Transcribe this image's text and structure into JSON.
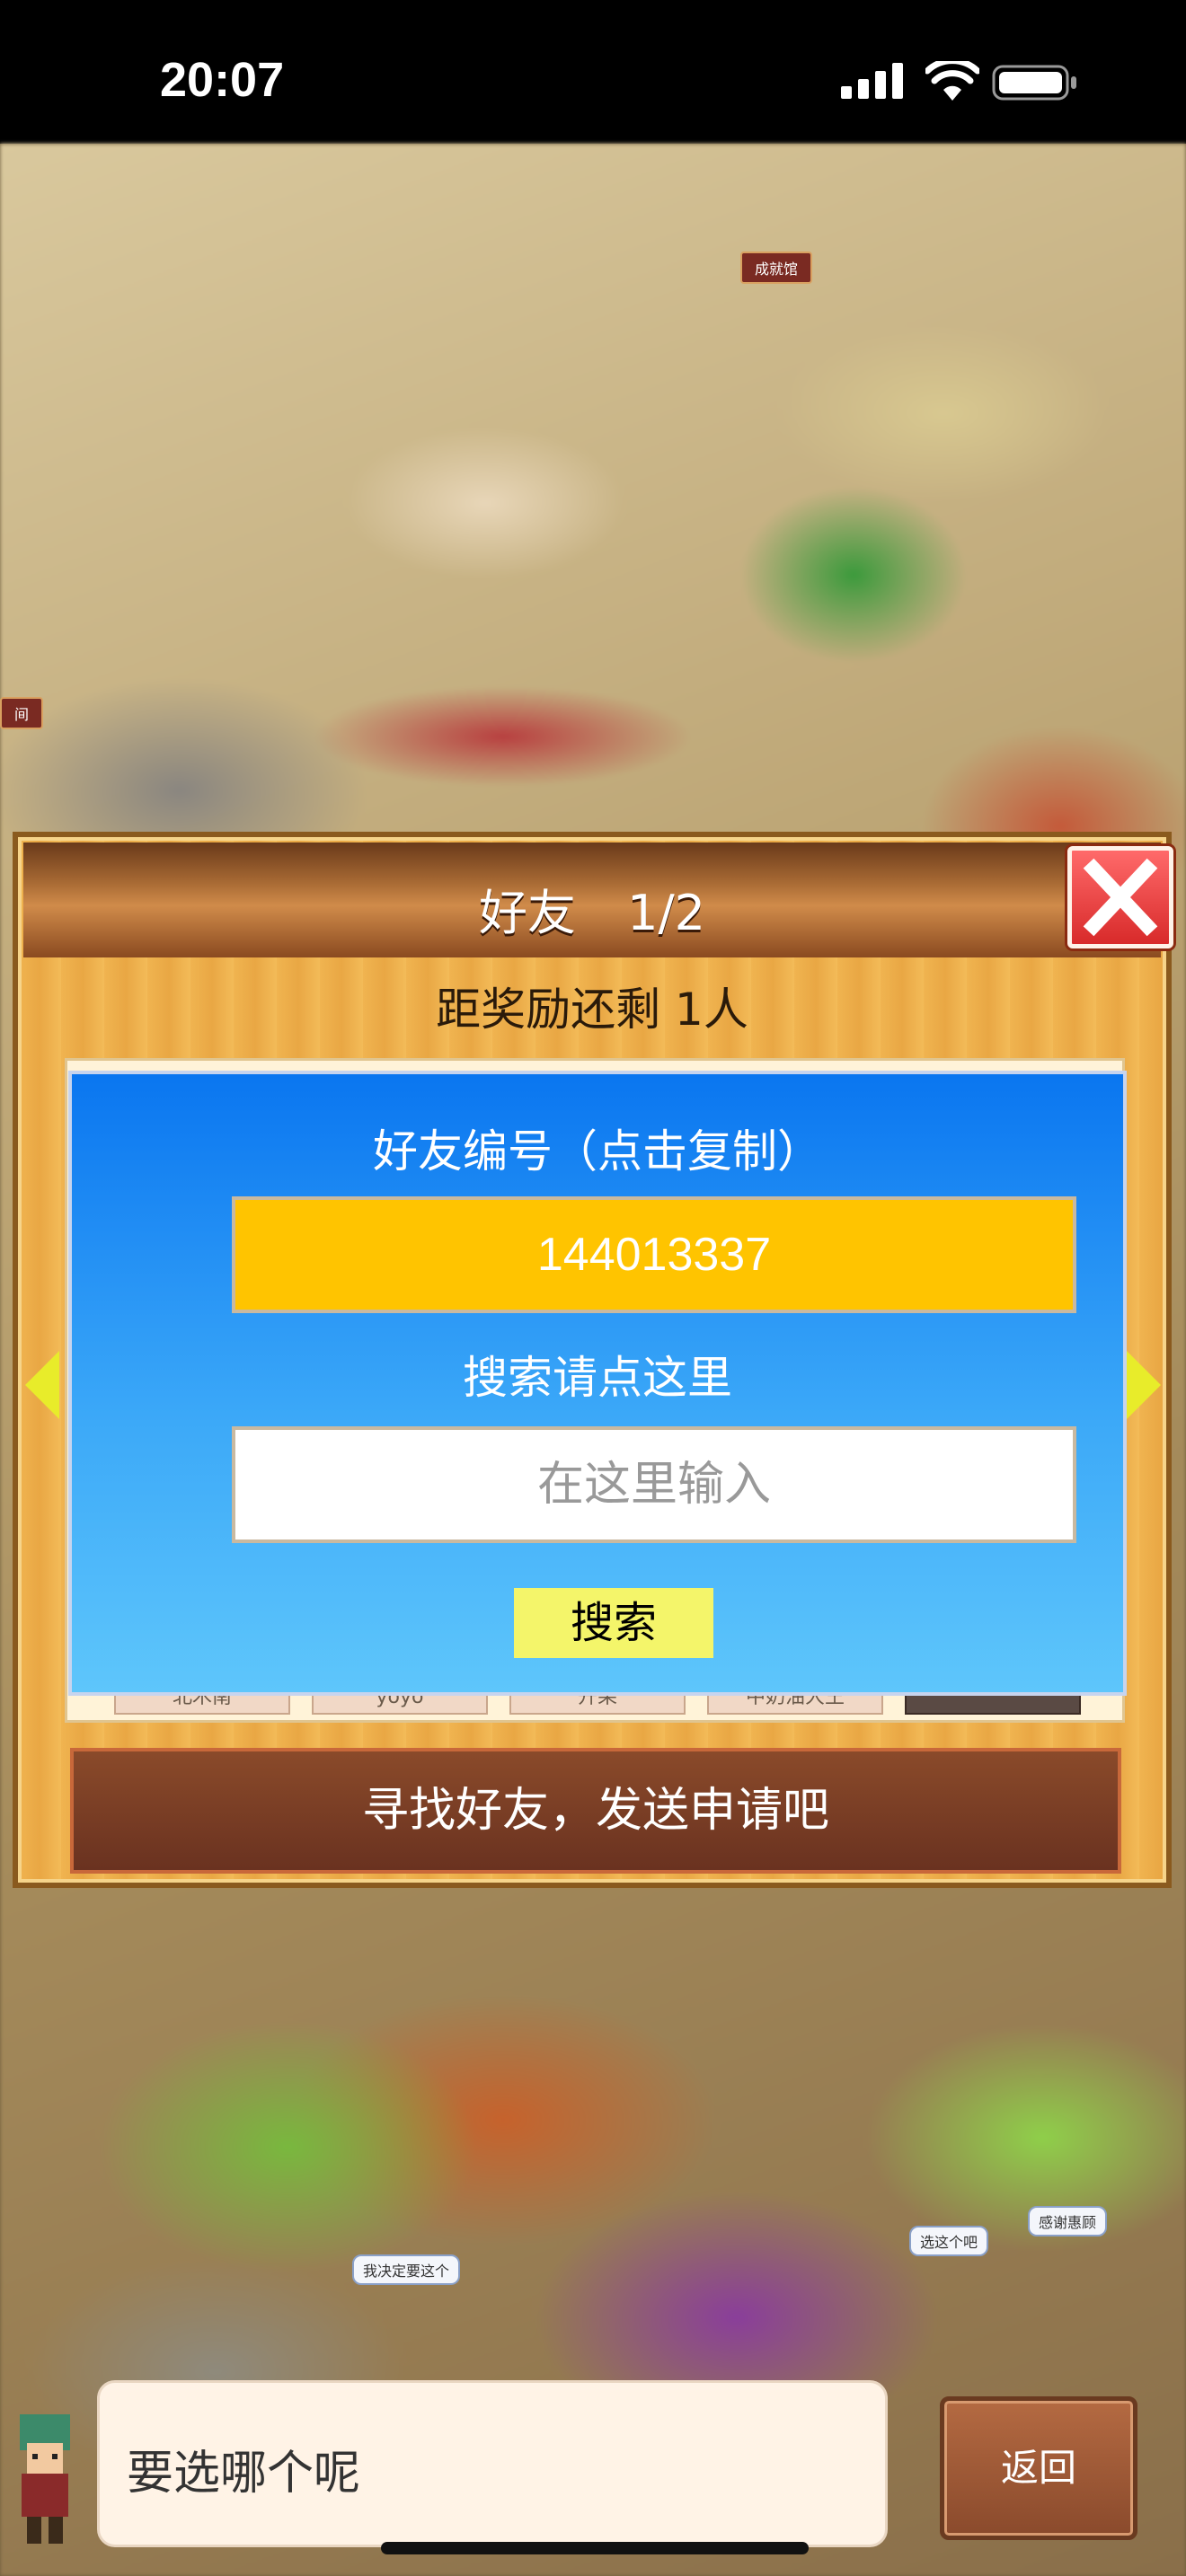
{
  "status_bar": {
    "time": "20:07"
  },
  "map_labels": {
    "hall": "成就馆",
    "left_edge": "间"
  },
  "map_bubbles": [
    "我决定要这个",
    "选这个吧",
    "感谢惠顾"
  ],
  "dialog": {
    "title": "好友  1/2",
    "reward_text": "距奖励还剩 1人",
    "friend_id_label": "好友编号（点击复制）",
    "friend_id": "144013337",
    "search_label": "搜索请点这里",
    "search_placeholder": "在这里输入",
    "search_button": "搜索",
    "find_friends_button": "寻找好友，发送申请吧",
    "list_tags": [
      "北木南",
      "yoyo",
      "开果",
      "中奶油大王",
      ""
    ]
  },
  "bottom": {
    "speech_text": "要选哪个呢",
    "back_button": "返回"
  },
  "colors": {
    "id_box": "#ffc400",
    "search_button": "#f4f56a",
    "close_button": "#e84040",
    "arrow": "#e8ec2a"
  }
}
